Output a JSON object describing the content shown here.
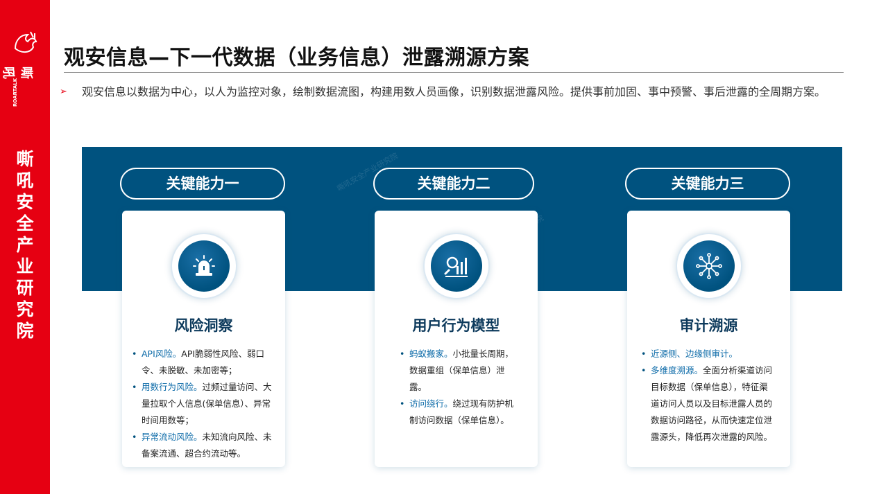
{
  "brand": {
    "logo_en": "ROARTALK",
    "logo_cn": "嘶吼",
    "vertical_name": [
      "嘶",
      "吼",
      "安",
      "全",
      "产",
      "业",
      "研",
      "究",
      "院"
    ]
  },
  "page": {
    "title": "观安信息—下一代数据（业务信息）泄露溯源方案",
    "intro": "观安信息以数据为中心，以人为监控对象，绘制数据流图，构建用数人员画像，识别数据泄露风险。提供事前加固、事中预警、事后泄露的全周期方案。",
    "intro_marker": "➢"
  },
  "colors": {
    "brand_red": "#e60012",
    "band_blue": "#00527f",
    "highlight": "#0b6aa8"
  },
  "capabilities": [
    {
      "pill": "关键能力一",
      "icon": "alarm-siren-icon",
      "title": "风险洞察",
      "items": [
        {
          "hl": "API风险。",
          "text": "API脆弱性风险、弱口令、未脱敏、未加密等；"
        },
        {
          "hl": "用数行为风险。",
          "text": "过频过量访问、大量拉取个人信息(保单信息）、异常时间用数等；"
        },
        {
          "hl": "异常流动风险。",
          "text": "未知流向风险、未备案流通、超合约流动等。"
        }
      ]
    },
    {
      "pill": "关键能力二",
      "icon": "analytics-chart-icon",
      "title": "用户行为模型",
      "items": [
        {
          "hl": "蚂蚁搬家。",
          "text": "小批量长周期，数据重组（保单信息）泄露。"
        },
        {
          "hl": "访问绕行。",
          "text": "绕过现有防护机制访问数据（保单信息）。"
        }
      ]
    },
    {
      "pill": "关键能力三",
      "icon": "network-hub-icon",
      "title": "审计溯源",
      "items": [
        {
          "hl": "近源侧、边缘侧审计。",
          "text": ""
        },
        {
          "hl": "多维度溯源。",
          "text": "全面分析渠道访问目标数据（保单信息），特征渠道访问人员以及目标泄露人员的数据访问路径，从而快速定位泄露源头，降低再次泄露的风险。"
        }
      ]
    }
  ],
  "watermark_text": "嘶吼安全产业研究院"
}
